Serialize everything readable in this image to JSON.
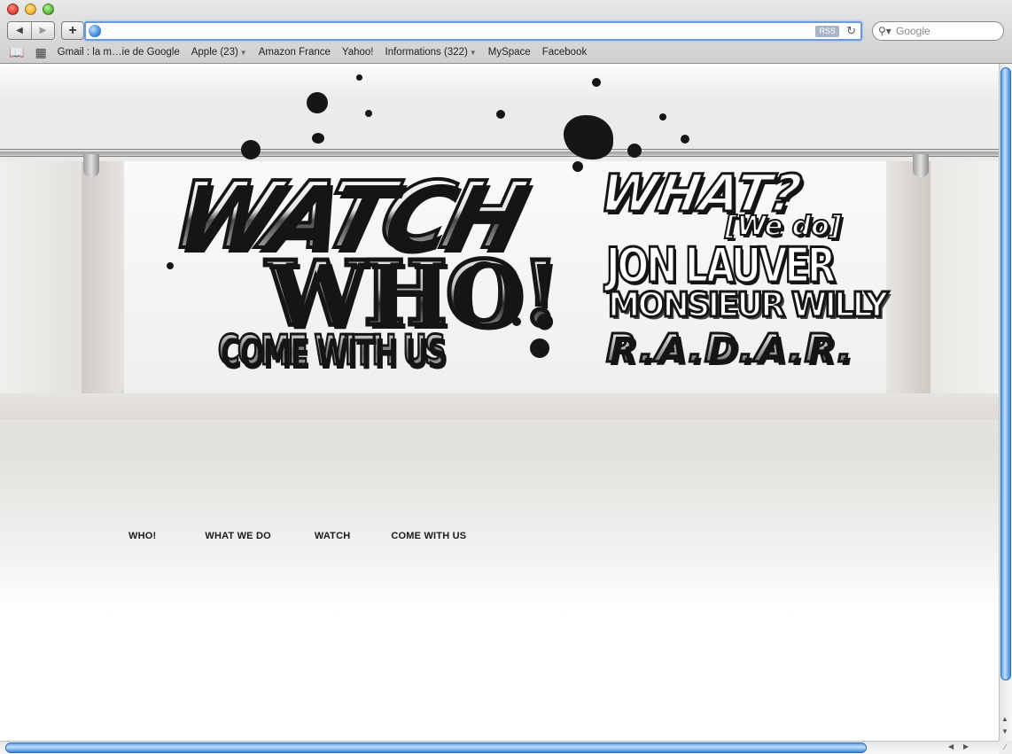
{
  "browser": {
    "url": "",
    "rss_label": "RSS",
    "search_placeholder": "Google",
    "bookmarks": [
      {
        "label": "Gmail : la m…ie de Google",
        "dropdown": false
      },
      {
        "label": "Apple (23)",
        "dropdown": true
      },
      {
        "label": "Amazon France",
        "dropdown": false
      },
      {
        "label": "Yahoo!",
        "dropdown": false
      },
      {
        "label": "Informations (322)",
        "dropdown": true
      },
      {
        "label": "MySpace",
        "dropdown": false
      },
      {
        "label": "Facebook",
        "dropdown": false
      }
    ]
  },
  "artwork": {
    "watch": "WATCH",
    "what": "WHAT?",
    "we_do": "[We do]",
    "who": "WHO!",
    "jon_lauver": "JON LAUVER",
    "monsieur_willy": "MONSIEUR WILLY",
    "radar": "R.A.D.A.R.",
    "come_with_us": "COME WITH US"
  },
  "site_nav": [
    {
      "label": "WHO!"
    },
    {
      "label": "WHAT WE DO"
    },
    {
      "label": "WATCH"
    },
    {
      "label": "COME WITH US"
    }
  ],
  "colors": {
    "focus_ring": "#6a9bd8",
    "scroll_thumb": "#5c9de6",
    "ink": "#151515"
  }
}
